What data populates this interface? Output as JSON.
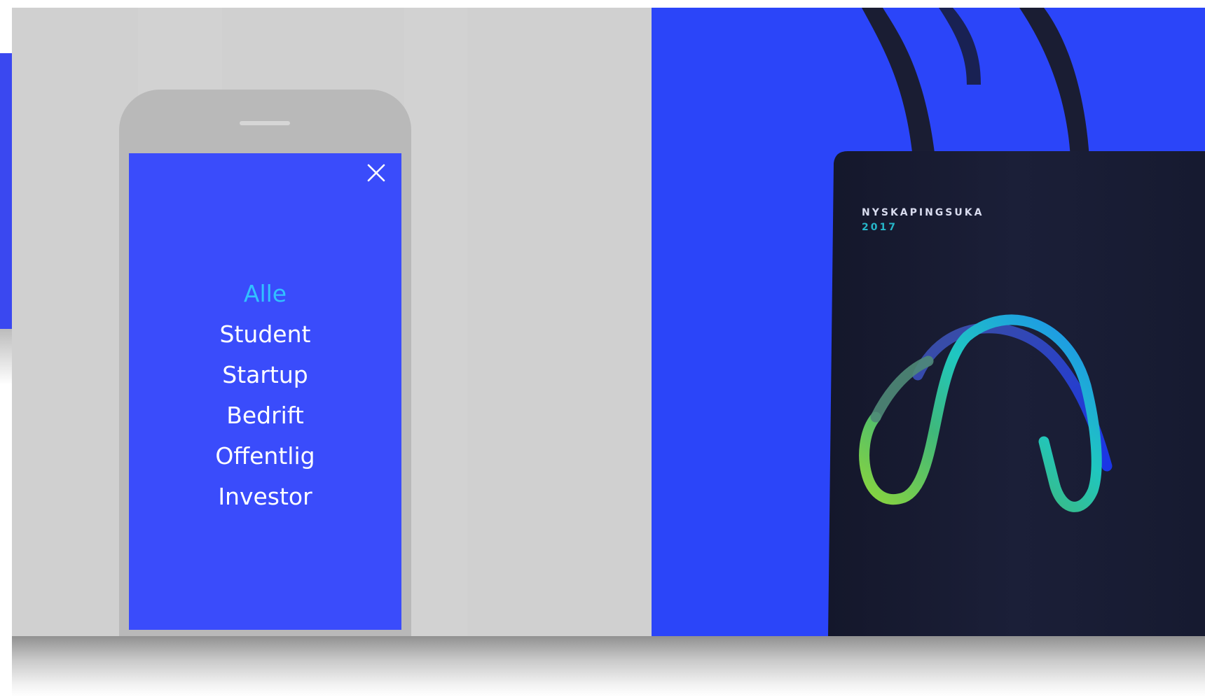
{
  "menu": {
    "close_icon": "close-icon",
    "items": [
      {
        "label": "Alle",
        "active": true
      },
      {
        "label": "Student",
        "active": false
      },
      {
        "label": "Startup",
        "active": false
      },
      {
        "label": "Bedrift",
        "active": false
      },
      {
        "label": "Offentlig",
        "active": false
      },
      {
        "label": "Investor",
        "active": false
      }
    ]
  },
  "tote_bag": {
    "brand": "NYSKAPINGSUKA",
    "year": "2017"
  },
  "colors": {
    "panel_grey": "#d0d0d0",
    "phone_frame": "#b9b9b9",
    "screen_blue": "#3a4cfb",
    "active_item": "#31c1ff",
    "photo_blue": "#2b45f9",
    "bag": "#171a33"
  }
}
